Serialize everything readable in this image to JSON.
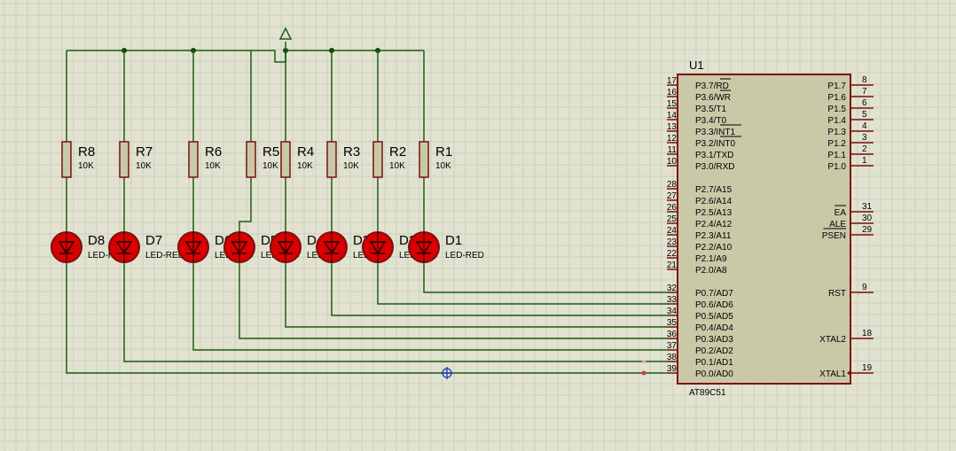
{
  "colors": {
    "background": "#e2e2d0",
    "grid": "#cfcfbd",
    "wire": "#1f5f14",
    "junction": "#0f4a0f",
    "body_fill": "#c9c9a8",
    "body_stroke": "#7a1010",
    "led_fill": "#d80000",
    "label": "#000000"
  },
  "mcu": {
    "ref": "U1",
    "part": "AT89C51",
    "left_pins": [
      {
        "num": "17",
        "name": "P3.7/RD",
        "bar": "RD"
      },
      {
        "num": "16",
        "name": "P3.6/WR",
        "bar": "WR"
      },
      {
        "num": "15",
        "name": "P3.5/T1"
      },
      {
        "num": "14",
        "name": "P3.4/T0"
      },
      {
        "num": "13",
        "name": "P3.3/INT1",
        "bar": "INT1"
      },
      {
        "num": "12",
        "name": "P3.2/INT0",
        "bar": "INT0"
      },
      {
        "num": "11",
        "name": "P3.1/TXD"
      },
      {
        "num": "10",
        "name": "P3.0/RXD"
      },
      {
        "num": "28",
        "name": "P2.7/A15"
      },
      {
        "num": "27",
        "name": "P2.6/A14"
      },
      {
        "num": "26",
        "name": "P2.5/A13"
      },
      {
        "num": "25",
        "name": "P2.4/A12"
      },
      {
        "num": "24",
        "name": "P2.3/A11"
      },
      {
        "num": "23",
        "name": "P2.2/A10"
      },
      {
        "num": "22",
        "name": "P2.1/A9"
      },
      {
        "num": "21",
        "name": "P2.0/A8"
      },
      {
        "num": "32",
        "name": "P0.7/AD7"
      },
      {
        "num": "33",
        "name": "P0.6/AD6"
      },
      {
        "num": "34",
        "name": "P0.5/AD5"
      },
      {
        "num": "35",
        "name": "P0.4/AD4"
      },
      {
        "num": "36",
        "name": "P0.3/AD3"
      },
      {
        "num": "37",
        "name": "P0.2/AD2"
      },
      {
        "num": "38",
        "name": "P0.1/AD1"
      },
      {
        "num": "39",
        "name": "P0.0/AD0"
      }
    ],
    "right_pins": [
      {
        "num": "8",
        "name": "P1.7"
      },
      {
        "num": "7",
        "name": "P1.6"
      },
      {
        "num": "6",
        "name": "P1.5"
      },
      {
        "num": "5",
        "name": "P1.4"
      },
      {
        "num": "4",
        "name": "P1.3"
      },
      {
        "num": "3",
        "name": "P1.2"
      },
      {
        "num": "2",
        "name": "P1.1"
      },
      {
        "num": "1",
        "name": "P1.0"
      },
      {
        "num": "31",
        "name": "EA",
        "bar": "EA"
      },
      {
        "num": "30",
        "name": "ALE"
      },
      {
        "num": "29",
        "name": "PSEN",
        "bar": "PSEN"
      },
      {
        "num": "9",
        "name": "RST"
      },
      {
        "num": "18",
        "name": "XTAL2"
      },
      {
        "num": "19",
        "name": "XTAL1"
      }
    ]
  },
  "resistors": [
    {
      "ref": "R8",
      "value": "10K"
    },
    {
      "ref": "R7",
      "value": "10K"
    },
    {
      "ref": "R6",
      "value": "10K"
    },
    {
      "ref": "R5",
      "value": "10K"
    },
    {
      "ref": "R4",
      "value": "10K"
    },
    {
      "ref": "R3",
      "value": "10K"
    },
    {
      "ref": "R2",
      "value": "10K"
    },
    {
      "ref": "R1",
      "value": "10K"
    }
  ],
  "leds": [
    {
      "ref": "D8",
      "type": "LED-RED"
    },
    {
      "ref": "D7",
      "type": "LED-RED"
    },
    {
      "ref": "D6",
      "type": "LED-RED"
    },
    {
      "ref": "D5",
      "type": "LED-RED"
    },
    {
      "ref": "D4",
      "type": "LED-RED"
    },
    {
      "ref": "D3",
      "type": "LED-RED"
    },
    {
      "ref": "D2",
      "type": "LED-RED"
    },
    {
      "ref": "D1",
      "type": "LED-RED"
    }
  ],
  "power": {
    "symbol": "power-terminal-icon"
  },
  "icons": {
    "cursor": "crosshair-cursor-icon"
  }
}
